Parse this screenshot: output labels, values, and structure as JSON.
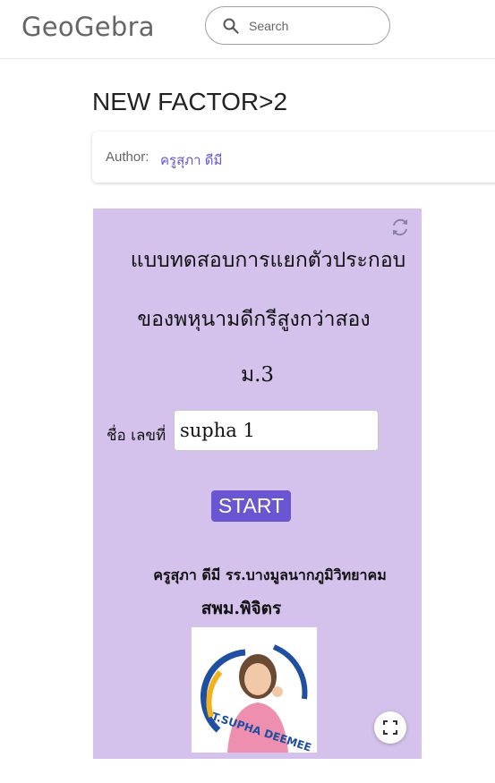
{
  "header": {
    "logo_text": "GeoGebra",
    "search": {
      "placeholder": "Search",
      "value": ""
    }
  },
  "page": {
    "title": "NEW FACTOR>2",
    "author_label": "Author:",
    "author_name": "ครูสุภา ดีมี"
  },
  "applet": {
    "line1": "แบบทดสอบการแยกตัวประกอบ",
    "line2": "ของพหุนามดีกรีสูงกว่าสอง",
    "line3": "ม.3",
    "name_label": "ชื่อ เลขที่",
    "name_value": "supha 1",
    "start_label": "START",
    "teacher_line": "ครูสุภา  ดีมี  รร.บางมูลนากภูมิวิทยาคม",
    "office_line": "สพม.พิจิตร",
    "photo_caption": "T.SUPHA DEEMEE"
  },
  "colors": {
    "accent": "#6557d2",
    "applet_bg": "#d4c2ec",
    "start_button": "#6a55d3"
  },
  "icons": [
    "search-icon",
    "refresh-icon",
    "fullscreen-icon"
  ]
}
